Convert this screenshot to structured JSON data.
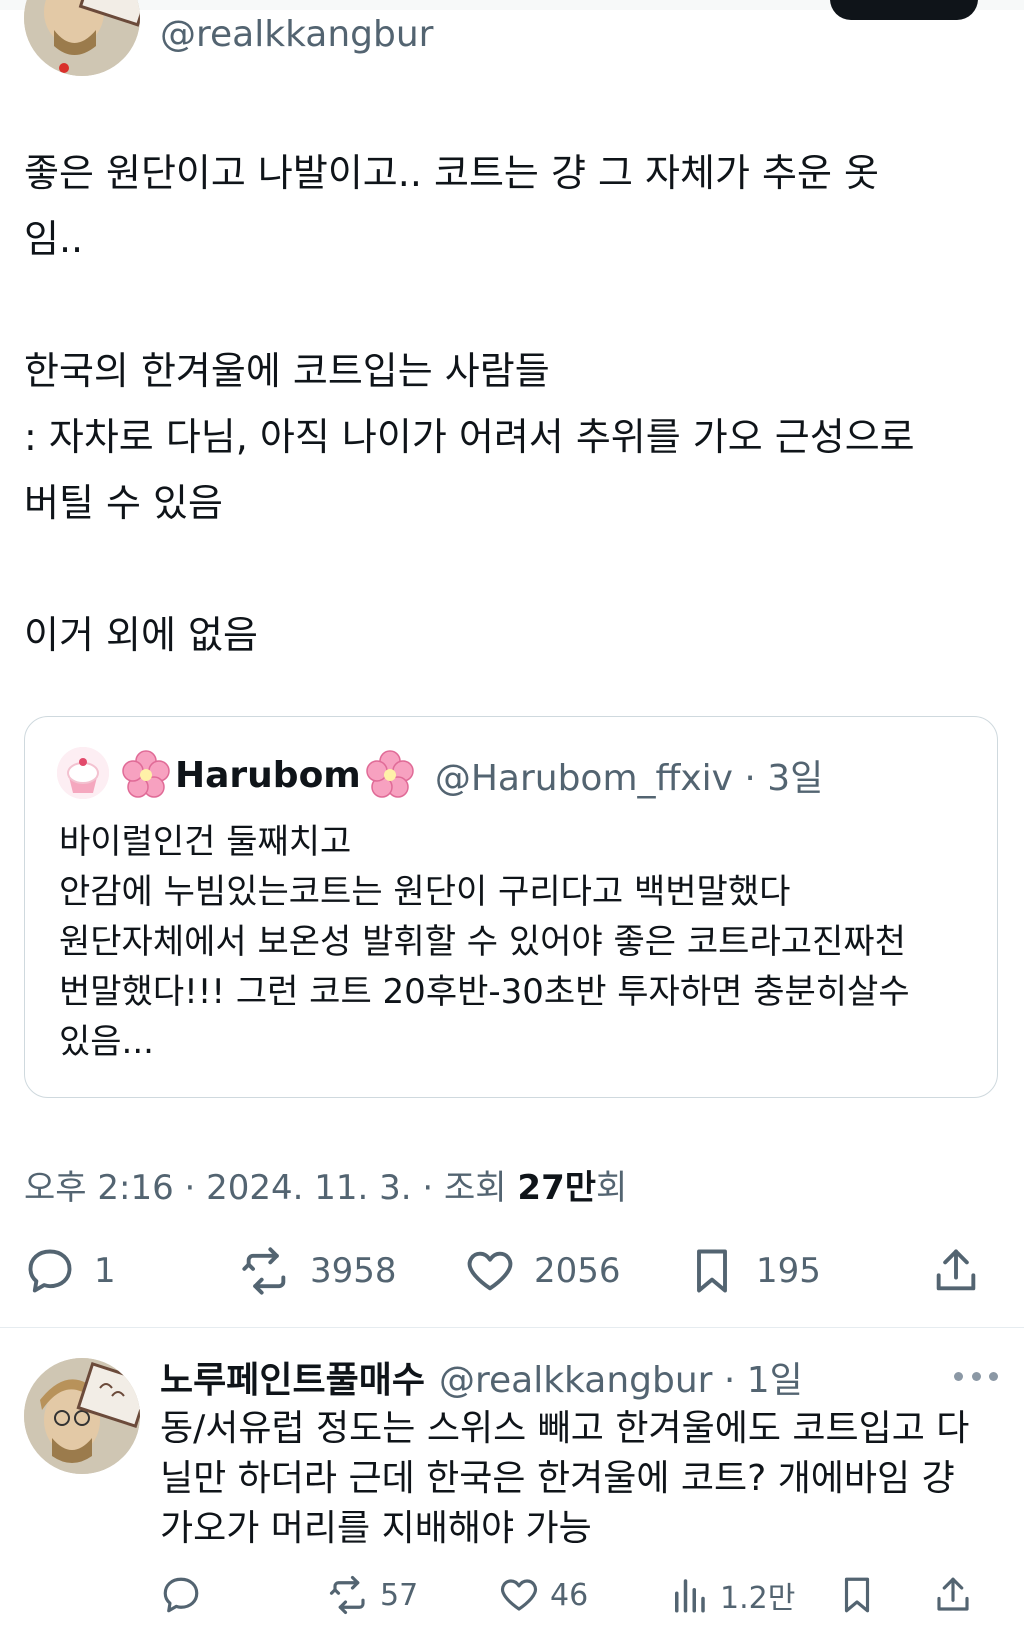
{
  "tweet": {
    "handle": "@realkkangbur",
    "text": "좋은 원단이고 나발이고.. 코트는 걍 그 자체가 추운 옷\n임..\n\n한국의 한겨울에 코트입는 사람들\n: 자차로 다님, 아직 나이가 어려서 추위를 가오 근성으로\n버틸 수 있음\n\n이거 외에 없음",
    "timestamp_prefix": "오후 2:16 · 2024. 11. 3. · 조회 ",
    "views_value": "27만",
    "views_suffix": "회",
    "stats": {
      "replies": "1",
      "retweets": "3958",
      "likes": "2056",
      "bookmarks": "195"
    }
  },
  "quote": {
    "name": "Harubom",
    "handle": "@Harubom_ffxiv · 3일",
    "text": "바이럴인건 둘째치고\n안감에 누빔있는코트는 원단이 구리다고 백번말했다\n원단자체에서 보온성 발휘할 수 있어야 좋은 코트라고진짜천\n번말했다!!! 그런 코트 20후반-30초반 투자하면 충분히살수\n있음..."
  },
  "reply": {
    "name": "노루페인트풀매수",
    "handle": "@realkkangbur · 1일",
    "text": "동/서유럽 정도는 스위스 빼고 한겨울에도 코트입고 다\n닐만 하더라 근데 한국은 한겨울에 코트? 개에바임 걍\n가오가 머리를 지배해야 가능",
    "stats": {
      "retweets": "57",
      "likes": "46",
      "views": "1.2만"
    }
  },
  "colors": {
    "text_primary": "#0f1419",
    "text_secondary": "#536471",
    "border": "#cfd9de"
  }
}
